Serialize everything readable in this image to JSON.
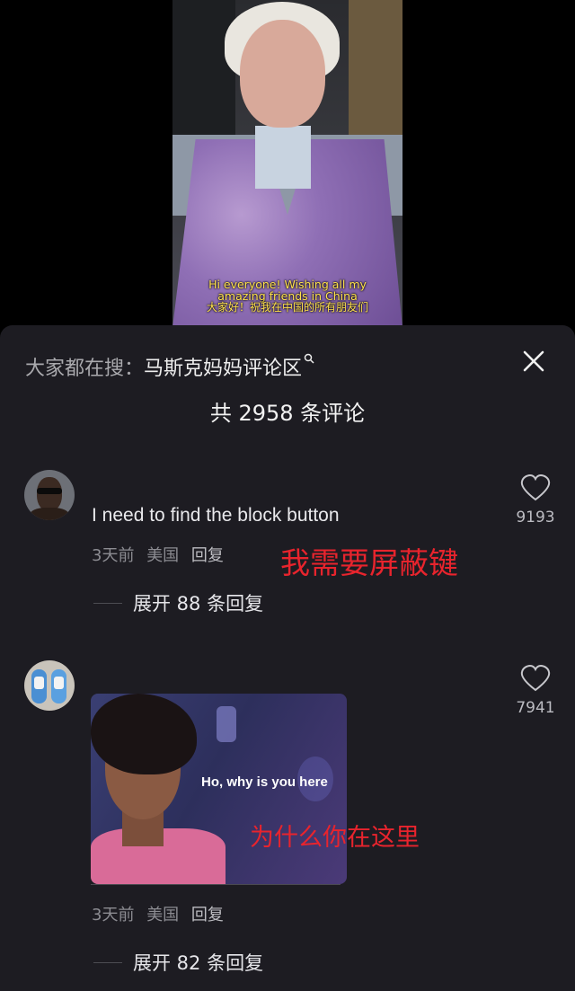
{
  "video": {
    "caption_line1": "Hi everyone! Wishing all my",
    "caption_line2": "amazing friends in China",
    "caption_line3": "大家好！祝我在中国的所有朋友们"
  },
  "comments_panel": {
    "search_prefix": "大家都在搜：",
    "search_topic": "马斯克妈妈评论区",
    "search_icon": "search-icon",
    "close_icon": "close-icon",
    "count_label": "共 2958 条评论",
    "comments": [
      {
        "avatar": "avatar-man-sunglasses",
        "text": "I need to find the block button",
        "time": "3天前",
        "location": "美国",
        "reply_label": "回复",
        "annotation": "我需要屏蔽键",
        "expand_label": "展开 88 条回复",
        "likes": "9193"
      },
      {
        "avatar": "avatar-sneakers",
        "gif_caption": "Ho, why is you here",
        "time": "3天前",
        "location": "美国",
        "reply_label": "回复",
        "annotation": "为什么你在这里",
        "expand_label": "展开 82 条回复",
        "likes": "7941"
      }
    ]
  },
  "colors": {
    "sheet_background": "#1d1c22",
    "annotation_red": "#e8242d",
    "caption_yellow": "#ffe14d"
  }
}
